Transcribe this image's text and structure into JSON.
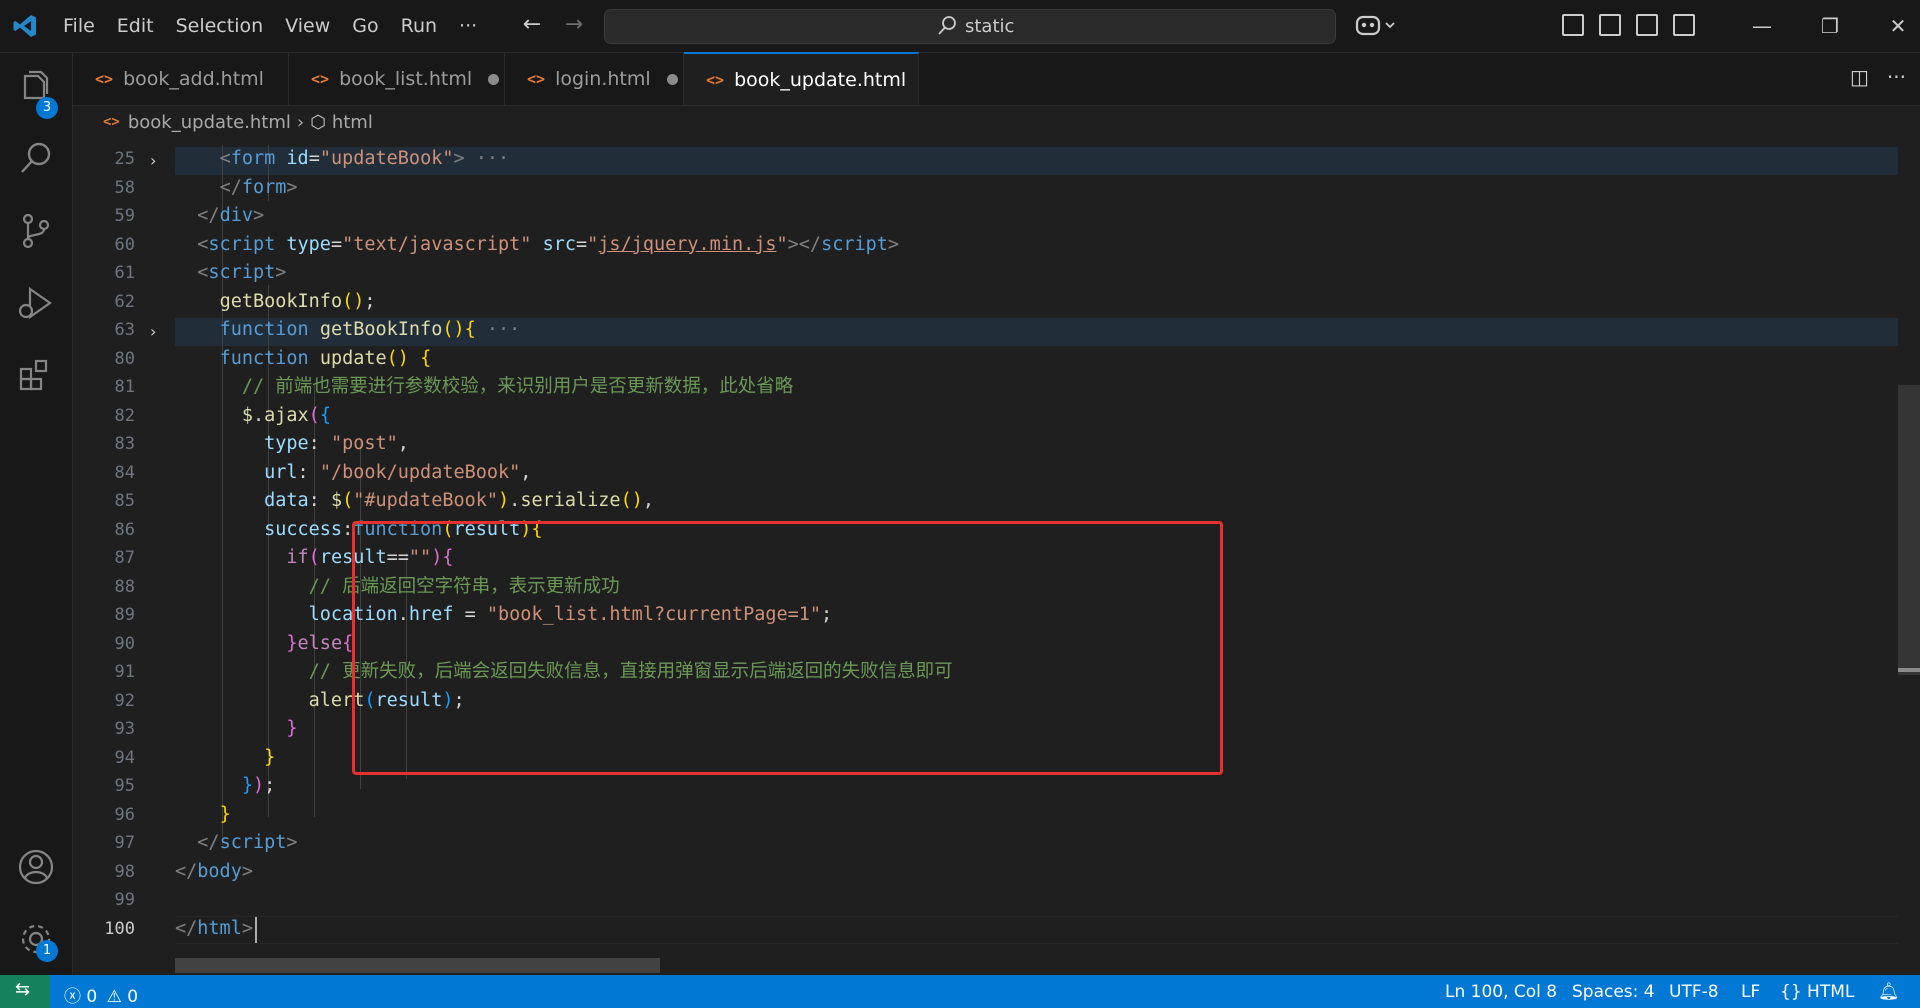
{
  "window": {
    "search_text": "static",
    "menu": [
      "File",
      "Edit",
      "Selection",
      "View",
      "Go",
      "Run",
      "···"
    ]
  },
  "activity_bar": {
    "explorer_badge": "3",
    "settings_badge": "1"
  },
  "tabs": [
    {
      "label": "book_add.html",
      "modified": false,
      "active": false
    },
    {
      "label": "book_list.html",
      "modified": true,
      "active": false
    },
    {
      "label": "login.html",
      "modified": true,
      "active": false
    },
    {
      "label": "book_update.html",
      "modified": true,
      "active": true
    }
  ],
  "breadcrumb": {
    "file": "book_update.html",
    "symbol": "html"
  },
  "editor": {
    "line_numbers": [
      "25",
      "58",
      "59",
      "60",
      "61",
      "62",
      "63",
      "80",
      "81",
      "82",
      "83",
      "84",
      "85",
      "86",
      "87",
      "88",
      "89",
      "90",
      "91",
      "92",
      "93",
      "94",
      "95",
      "96",
      "97",
      "98",
      "99",
      "100"
    ],
    "code": {
      "l25_tag": "form",
      "l25_attr": "id",
      "l25_val": "\"updateBook\"",
      "l25_fold": "···",
      "l58_tag": "form",
      "l59_tag": "div",
      "l60_tag": "script",
      "l60_attr1": "type",
      "l60_val1": "\"text/javascript\"",
      "l60_attr2": "src",
      "l60_val2": "js/jquery.min.js",
      "l60_endtag": "script",
      "l61_tag": "script",
      "l62_fn": "getBookInfo",
      "l63_kw": "function",
      "l63_fn": "getBookInfo",
      "l63_fold": "···",
      "l80_kw": "function",
      "l80_fn": "update",
      "l81_comment": "// 前端也需要进行参数校验，来识别用户是否更新数据，此处省略",
      "l82_obj": "$",
      "l82_fn": "ajax",
      "l83_key": "type",
      "l83_val": "\"post\"",
      "l84_key": "url",
      "l84_val": "\"/book/updateBook\"",
      "l85_key": "data",
      "l85_obj": "$",
      "l85_val": "\"#updateBook\"",
      "l85_fn": "serialize",
      "l86_key": "success",
      "l86_kw": "function",
      "l86_param": "result",
      "l87_kw": "if",
      "l87_var": "result",
      "l87_val": "\"\"",
      "l88_comment": "// 后端返回空字符串，表示更新成功",
      "l89_obj": "location",
      "l89_prop": "href",
      "l89_val": "\"book_list.html?currentPage=1\"",
      "l90_kw": "else",
      "l91_comment": "// 更新失败，后端会返回失败信息，直接用弹窗显示后端返回的失败信息即可",
      "l92_fn": "alert",
      "l92_var": "result",
      "l97_tag": "script",
      "l98_tag": "body",
      "l100_tag": "html"
    }
  },
  "status_bar": {
    "errors": "0",
    "warnings": "0",
    "position": "Ln 100, Col 8",
    "spaces": "Spaces: 4",
    "encoding": "UTF-8",
    "eol": "LF",
    "language": "HTML"
  }
}
